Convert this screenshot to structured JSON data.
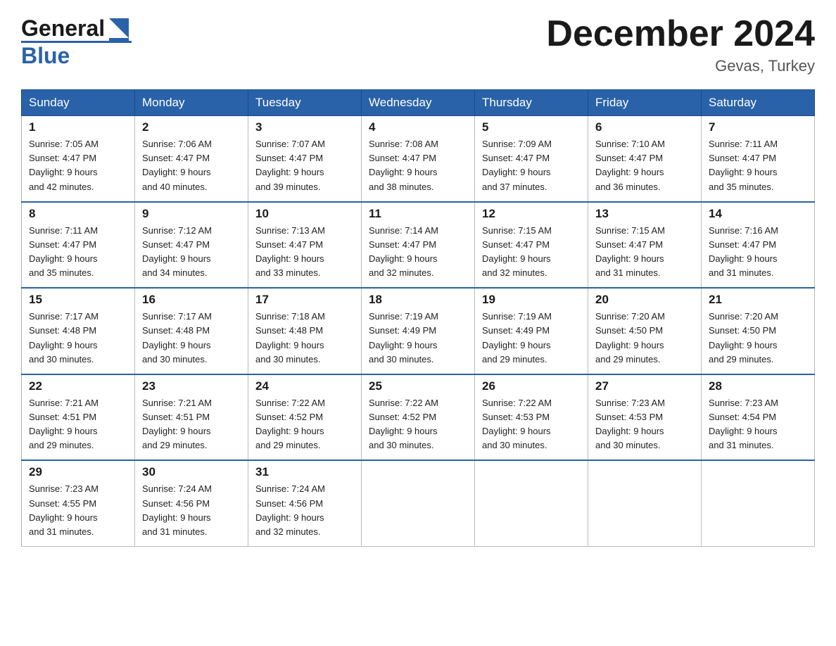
{
  "header": {
    "logo_general": "General",
    "logo_blue": "Blue",
    "month_title": "December 2024",
    "location": "Gevas, Turkey"
  },
  "weekdays": [
    "Sunday",
    "Monday",
    "Tuesday",
    "Wednesday",
    "Thursday",
    "Friday",
    "Saturday"
  ],
  "weeks": [
    [
      {
        "day": "1",
        "sunrise": "7:05 AM",
        "sunset": "4:47 PM",
        "daylight": "9 hours and 42 minutes."
      },
      {
        "day": "2",
        "sunrise": "7:06 AM",
        "sunset": "4:47 PM",
        "daylight": "9 hours and 40 minutes."
      },
      {
        "day": "3",
        "sunrise": "7:07 AM",
        "sunset": "4:47 PM",
        "daylight": "9 hours and 39 minutes."
      },
      {
        "day": "4",
        "sunrise": "7:08 AM",
        "sunset": "4:47 PM",
        "daylight": "9 hours and 38 minutes."
      },
      {
        "day": "5",
        "sunrise": "7:09 AM",
        "sunset": "4:47 PM",
        "daylight": "9 hours and 37 minutes."
      },
      {
        "day": "6",
        "sunrise": "7:10 AM",
        "sunset": "4:47 PM",
        "daylight": "9 hours and 36 minutes."
      },
      {
        "day": "7",
        "sunrise": "7:11 AM",
        "sunset": "4:47 PM",
        "daylight": "9 hours and 35 minutes."
      }
    ],
    [
      {
        "day": "8",
        "sunrise": "7:11 AM",
        "sunset": "4:47 PM",
        "daylight": "9 hours and 35 minutes."
      },
      {
        "day": "9",
        "sunrise": "7:12 AM",
        "sunset": "4:47 PM",
        "daylight": "9 hours and 34 minutes."
      },
      {
        "day": "10",
        "sunrise": "7:13 AM",
        "sunset": "4:47 PM",
        "daylight": "9 hours and 33 minutes."
      },
      {
        "day": "11",
        "sunrise": "7:14 AM",
        "sunset": "4:47 PM",
        "daylight": "9 hours and 32 minutes."
      },
      {
        "day": "12",
        "sunrise": "7:15 AM",
        "sunset": "4:47 PM",
        "daylight": "9 hours and 32 minutes."
      },
      {
        "day": "13",
        "sunrise": "7:15 AM",
        "sunset": "4:47 PM",
        "daylight": "9 hours and 31 minutes."
      },
      {
        "day": "14",
        "sunrise": "7:16 AM",
        "sunset": "4:47 PM",
        "daylight": "9 hours and 31 minutes."
      }
    ],
    [
      {
        "day": "15",
        "sunrise": "7:17 AM",
        "sunset": "4:48 PM",
        "daylight": "9 hours and 30 minutes."
      },
      {
        "day": "16",
        "sunrise": "7:17 AM",
        "sunset": "4:48 PM",
        "daylight": "9 hours and 30 minutes."
      },
      {
        "day": "17",
        "sunrise": "7:18 AM",
        "sunset": "4:48 PM",
        "daylight": "9 hours and 30 minutes."
      },
      {
        "day": "18",
        "sunrise": "7:19 AM",
        "sunset": "4:49 PM",
        "daylight": "9 hours and 30 minutes."
      },
      {
        "day": "19",
        "sunrise": "7:19 AM",
        "sunset": "4:49 PM",
        "daylight": "9 hours and 29 minutes."
      },
      {
        "day": "20",
        "sunrise": "7:20 AM",
        "sunset": "4:50 PM",
        "daylight": "9 hours and 29 minutes."
      },
      {
        "day": "21",
        "sunrise": "7:20 AM",
        "sunset": "4:50 PM",
        "daylight": "9 hours and 29 minutes."
      }
    ],
    [
      {
        "day": "22",
        "sunrise": "7:21 AM",
        "sunset": "4:51 PM",
        "daylight": "9 hours and 29 minutes."
      },
      {
        "day": "23",
        "sunrise": "7:21 AM",
        "sunset": "4:51 PM",
        "daylight": "9 hours and 29 minutes."
      },
      {
        "day": "24",
        "sunrise": "7:22 AM",
        "sunset": "4:52 PM",
        "daylight": "9 hours and 29 minutes."
      },
      {
        "day": "25",
        "sunrise": "7:22 AM",
        "sunset": "4:52 PM",
        "daylight": "9 hours and 30 minutes."
      },
      {
        "day": "26",
        "sunrise": "7:22 AM",
        "sunset": "4:53 PM",
        "daylight": "9 hours and 30 minutes."
      },
      {
        "day": "27",
        "sunrise": "7:23 AM",
        "sunset": "4:53 PM",
        "daylight": "9 hours and 30 minutes."
      },
      {
        "day": "28",
        "sunrise": "7:23 AM",
        "sunset": "4:54 PM",
        "daylight": "9 hours and 31 minutes."
      }
    ],
    [
      {
        "day": "29",
        "sunrise": "7:23 AM",
        "sunset": "4:55 PM",
        "daylight": "9 hours and 31 minutes."
      },
      {
        "day": "30",
        "sunrise": "7:24 AM",
        "sunset": "4:56 PM",
        "daylight": "9 hours and 31 minutes."
      },
      {
        "day": "31",
        "sunrise": "7:24 AM",
        "sunset": "4:56 PM",
        "daylight": "9 hours and 32 minutes."
      },
      null,
      null,
      null,
      null
    ]
  ],
  "labels": {
    "sunrise": "Sunrise:",
    "sunset": "Sunset:",
    "daylight": "Daylight:"
  }
}
